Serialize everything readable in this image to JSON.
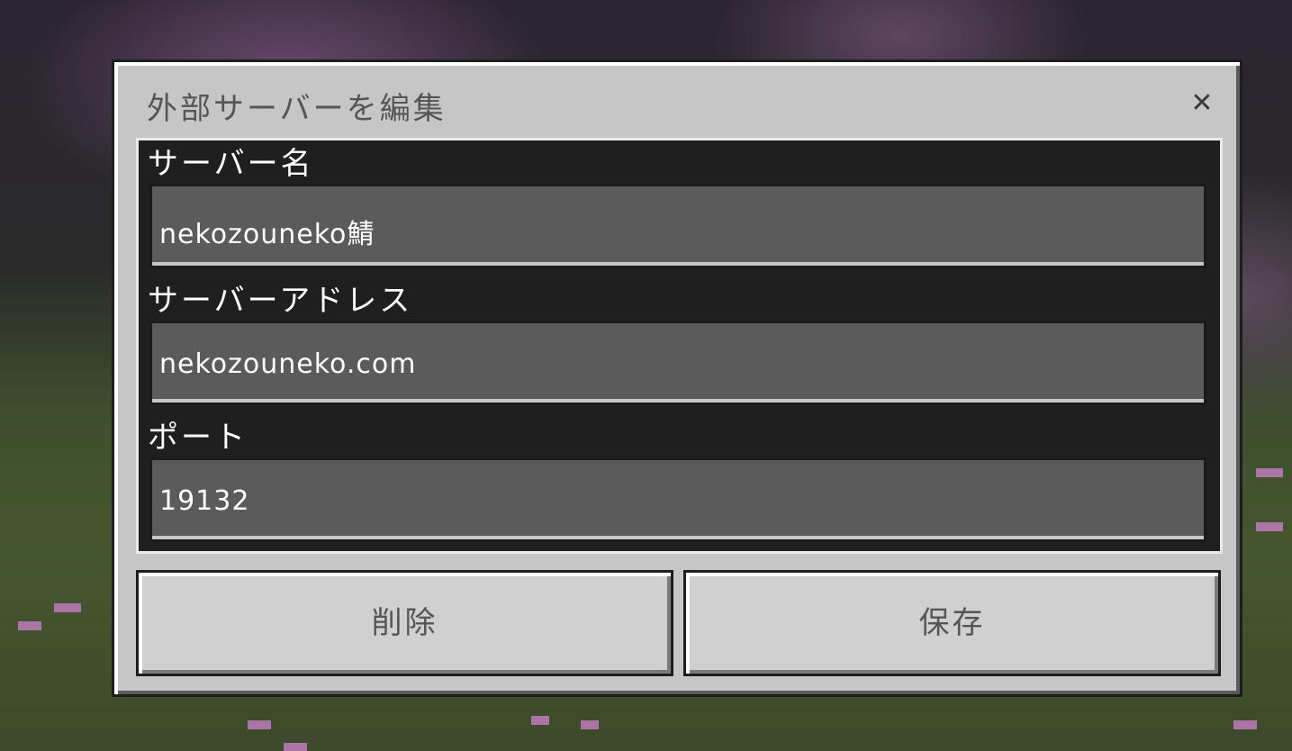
{
  "dialog": {
    "title": "外部サーバーを編集",
    "close_icon": "✕"
  },
  "fields": [
    {
      "label": "サーバー名",
      "value": "nekozouneko鯖"
    },
    {
      "label": "サーバーアドレス",
      "value": "nekozouneko.com"
    },
    {
      "label": "ポート",
      "value": "19132"
    }
  ],
  "buttons": {
    "delete_label": "削除",
    "save_label": "保存"
  },
  "colors": {
    "dialog_bg": "#c6c6c6",
    "input_bg": "#5b5b5b",
    "blossom": "#c67fc4"
  }
}
